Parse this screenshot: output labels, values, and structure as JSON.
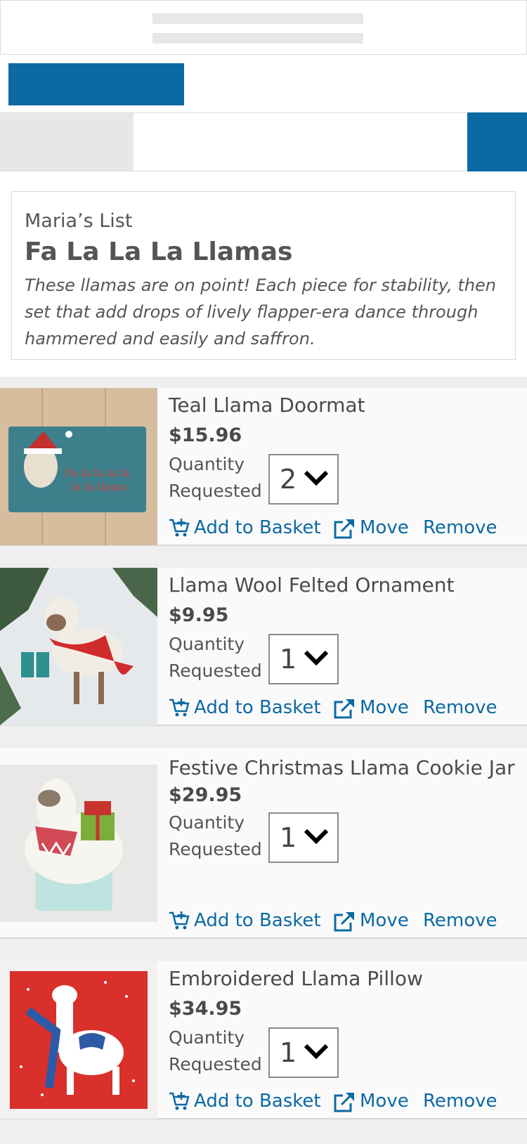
{
  "list": {
    "owner": "Maria’s List",
    "title": "Fa La La La Llamas",
    "description": "These llamas are on point! Each piece for stability, then set that add drops of lively flapper-era dance through hammered and easily and saffron."
  },
  "labels": {
    "quantity": "Quantity Requested",
    "add_to_basket": "Add to Basket",
    "move": "Move",
    "remove": "Remove"
  },
  "colors": {
    "accent": "#0b69a3",
    "background": "#efefef",
    "card": "#fbfafb"
  },
  "products": [
    {
      "name": "Teal Llama Doormat",
      "price": "$15.96",
      "quantity": "2",
      "image": "teal-llama-doormat-image"
    },
    {
      "name": "Llama Wool Felted Ornament",
      "price": "$9.95",
      "quantity": "1",
      "image": "llama-felted-ornament-image"
    },
    {
      "name": "Festive Christmas Llama Cookie Jar",
      "price": "$29.95",
      "quantity": "1",
      "image": "llama-cookie-jar-image"
    },
    {
      "name": "Embroidered Llama Pillow",
      "price": "$34.95",
      "quantity": "1",
      "image": "embroidered-llama-pillow-image"
    }
  ]
}
